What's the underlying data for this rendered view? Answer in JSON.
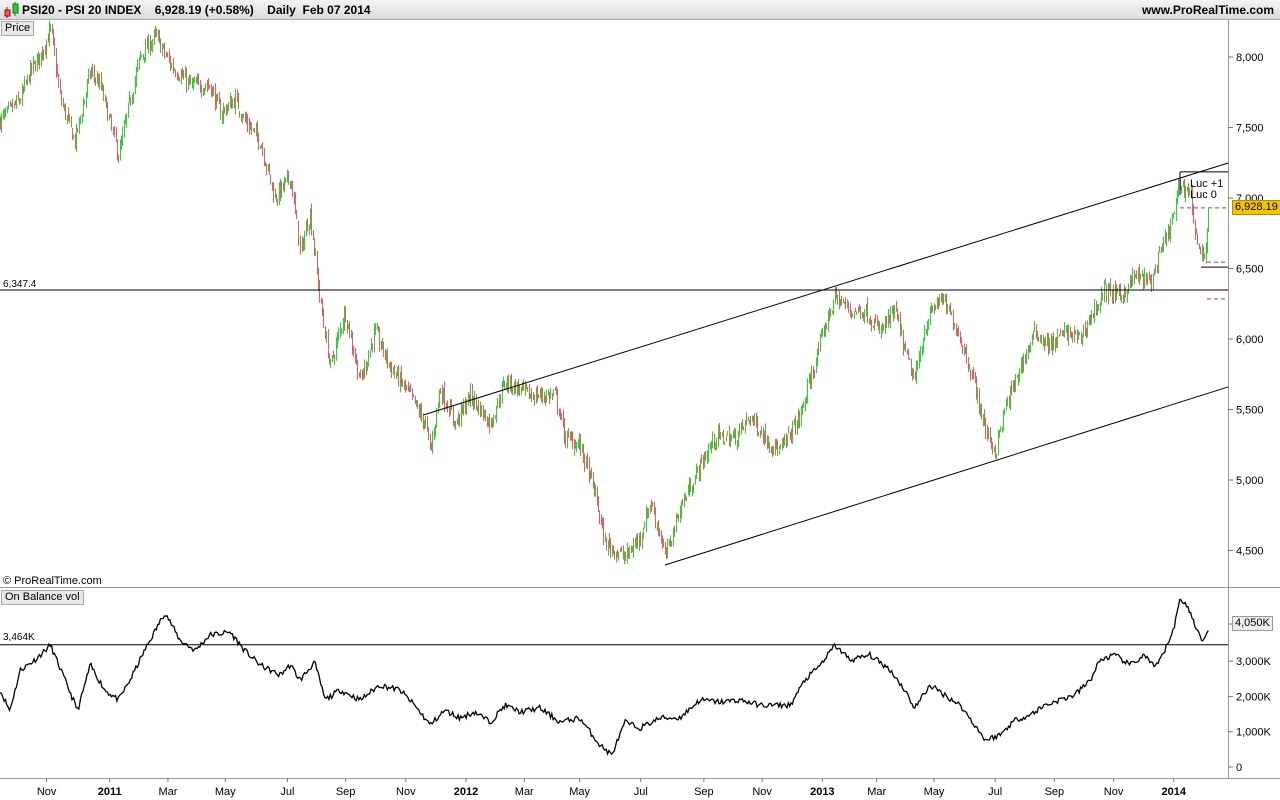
{
  "header": {
    "symbol": "PSI20 - PSI 20 INDEX",
    "last": "6,928.19 (+0.58%)",
    "period": "Daily",
    "date": "Feb 07 2014",
    "site": "www.ProRealTime.com"
  },
  "price_panel": {
    "label": "Price",
    "copyright": "© ProRealTime.com",
    "hline_label": "6,347.4",
    "last_label": "6,928.19",
    "annotations": [
      "Luc +1",
      "Luc 0"
    ]
  },
  "obv_panel": {
    "label": "On Balance vol",
    "hline_label": "3,464K",
    "last_label": "4,050K"
  },
  "colors": {
    "up": "#33cc33",
    "down": "#e06060",
    "last_bg": "#f5c400"
  },
  "chart_data": [
    {
      "type": "candlestick",
      "title": "PSI20 - PSI 20 INDEX Daily",
      "x_unit": "days since first bar",
      "ylim": [
        4300,
        8300
      ],
      "yticks": [
        4500,
        5000,
        5500,
        6000,
        6500,
        7000,
        7500,
        8000
      ],
      "ytick_labels": [
        "4,500",
        "5,000",
        "5,500",
        "6,000",
        "6,500",
        "7,000",
        "7,500",
        "8,000"
      ],
      "close_path": [
        [
          0,
          7550
        ],
        [
          21,
          7700
        ],
        [
          31,
          7900
        ],
        [
          41,
          8000
        ],
        [
          52,
          8200
        ],
        [
          62,
          7700
        ],
        [
          77,
          7400
        ],
        [
          93,
          7900
        ],
        [
          103,
          7800
        ],
        [
          122,
          7300
        ],
        [
          134,
          7700
        ],
        [
          144,
          8000
        ],
        [
          160,
          8150
        ],
        [
          175,
          7950
        ],
        [
          196,
          7800
        ],
        [
          216,
          7800
        ],
        [
          227,
          7600
        ],
        [
          242,
          7700
        ],
        [
          252,
          7550
        ],
        [
          268,
          7400
        ],
        [
          283,
          7000
        ],
        [
          299,
          7150
        ],
        [
          309,
          6600
        ],
        [
          319,
          6900
        ],
        [
          330,
          6250
        ],
        [
          340,
          5800
        ],
        [
          355,
          6200
        ],
        [
          371,
          5700
        ],
        [
          386,
          6050
        ],
        [
          402,
          5800
        ],
        [
          422,
          5600
        ],
        [
          438,
          5400
        ],
        [
          443,
          5200
        ],
        [
          453,
          5650
        ],
        [
          469,
          5400
        ],
        [
          484,
          5600
        ],
        [
          505,
          5400
        ],
        [
          520,
          5700
        ],
        [
          546,
          5600
        ],
        [
          572,
          5600
        ],
        [
          582,
          5300
        ],
        [
          597,
          5250
        ],
        [
          613,
          4900
        ],
        [
          623,
          4550
        ],
        [
          644,
          4450
        ],
        [
          659,
          4600
        ],
        [
          670,
          4850
        ],
        [
          680,
          4600
        ],
        [
          685,
          4450
        ],
        [
          700,
          4800
        ],
        [
          721,
          5100
        ],
        [
          736,
          5300
        ],
        [
          757,
          5300
        ],
        [
          773,
          5450
        ],
        [
          788,
          5300
        ],
        [
          803,
          5200
        ],
        [
          824,
          5450
        ],
        [
          834,
          5700
        ],
        [
          850,
          6100
        ],
        [
          860,
          6300
        ],
        [
          876,
          6200
        ],
        [
          891,
          6200
        ],
        [
          906,
          6050
        ],
        [
          922,
          6200
        ],
        [
          932,
          5900
        ],
        [
          942,
          5700
        ],
        [
          953,
          6100
        ],
        [
          968,
          6300
        ],
        [
          984,
          6100
        ],
        [
          999,
          5800
        ],
        [
          1015,
          5350
        ],
        [
          1025,
          5200
        ],
        [
          1035,
          5500
        ],
        [
          1051,
          5800
        ],
        [
          1066,
          6050
        ],
        [
          1082,
          5950
        ],
        [
          1097,
          6050
        ],
        [
          1112,
          6000
        ],
        [
          1123,
          6150
        ],
        [
          1138,
          6350
        ],
        [
          1154,
          6300
        ],
        [
          1169,
          6450
        ],
        [
          1185,
          6400
        ],
        [
          1200,
          6700
        ],
        [
          1210,
          6900
        ],
        [
          1215,
          7100
        ],
        [
          1226,
          7050
        ],
        [
          1231,
          6750
        ],
        [
          1239,
          6550
        ],
        [
          1246,
          6928.19
        ]
      ],
      "lines": [
        {
          "name": "channel-top",
          "from": [
            436,
            5461
          ],
          "to": [
            1265,
            7248
          ]
        },
        {
          "name": "channel-bottom",
          "from": [
            685,
            4397
          ],
          "to": [
            1265,
            5660
          ]
        },
        {
          "name": "support",
          "value": 6347.4
        }
      ],
      "markers": [
        {
          "name": "luc-plus-1",
          "value": 7185
        },
        {
          "name": "luc-0",
          "value": 6510
        }
      ],
      "dashed_levels": [
        6930,
        6545,
        6285
      ]
    },
    {
      "type": "line",
      "title": "On Balance vol",
      "ylim": [
        -300,
        5000
      ],
      "yticks": [
        0,
        1000,
        2000,
        3000,
        4050
      ],
      "ytick_labels": [
        "0",
        "1,000K",
        "2,000K",
        "3,000K",
        "4,050K"
      ],
      "points": [
        [
          0,
          2180
        ],
        [
          10,
          1600
        ],
        [
          21,
          2750
        ],
        [
          36,
          3030
        ],
        [
          52,
          3450
        ],
        [
          67,
          2460
        ],
        [
          80,
          1600
        ],
        [
          93,
          2890
        ],
        [
          108,
          2180
        ],
        [
          122,
          1900
        ],
        [
          134,
          2460
        ],
        [
          149,
          3300
        ],
        [
          170,
          4390
        ],
        [
          185,
          3600
        ],
        [
          201,
          3300
        ],
        [
          216,
          3740
        ],
        [
          237,
          3820
        ],
        [
          252,
          3300
        ],
        [
          268,
          2890
        ],
        [
          288,
          2600
        ],
        [
          299,
          2890
        ],
        [
          309,
          2460
        ],
        [
          324,
          2970
        ],
        [
          335,
          1900
        ],
        [
          350,
          2180
        ],
        [
          371,
          1900
        ],
        [
          391,
          2320
        ],
        [
          412,
          2180
        ],
        [
          427,
          1750
        ],
        [
          443,
          1190
        ],
        [
          458,
          1600
        ],
        [
          474,
          1390
        ],
        [
          489,
          1560
        ],
        [
          505,
          1270
        ],
        [
          520,
          1750
        ],
        [
          536,
          1560
        ],
        [
          556,
          1670
        ],
        [
          577,
          1270
        ],
        [
          597,
          1390
        ],
        [
          618,
          620
        ],
        [
          630,
          340
        ],
        [
          644,
          1270
        ],
        [
          659,
          1100
        ],
        [
          680,
          1390
        ],
        [
          700,
          1390
        ],
        [
          721,
          1900
        ],
        [
          742,
          1840
        ],
        [
          762,
          1900
        ],
        [
          783,
          1750
        ],
        [
          814,
          1750
        ],
        [
          829,
          2460
        ],
        [
          845,
          2890
        ],
        [
          860,
          3450
        ],
        [
          876,
          3030
        ],
        [
          896,
          3170
        ],
        [
          917,
          2750
        ],
        [
          932,
          2180
        ],
        [
          942,
          1670
        ],
        [
          958,
          2320
        ],
        [
          973,
          2040
        ],
        [
          989,
          1750
        ],
        [
          1004,
          1190
        ],
        [
          1015,
          760
        ],
        [
          1030,
          910
        ],
        [
          1045,
          1330
        ],
        [
          1061,
          1470
        ],
        [
          1076,
          1750
        ],
        [
          1092,
          1900
        ],
        [
          1107,
          2040
        ],
        [
          1123,
          2460
        ],
        [
          1133,
          3030
        ],
        [
          1148,
          3170
        ],
        [
          1164,
          2890
        ],
        [
          1179,
          3170
        ],
        [
          1190,
          2800
        ],
        [
          1200,
          3300
        ],
        [
          1210,
          4020
        ],
        [
          1215,
          4730
        ],
        [
          1221,
          4670
        ],
        [
          1231,
          4020
        ],
        [
          1239,
          3510
        ],
        [
          1246,
          4050
        ]
      ],
      "hline": 3464
    },
    {
      "type": "x-axis",
      "labels": [
        {
          "text": "Nov",
          "day": 48
        },
        {
          "text": "2011",
          "day": 113
        },
        {
          "text": "Mar",
          "day": 173
        },
        {
          "text": "May",
          "day": 232
        },
        {
          "text": "Jul",
          "day": 296
        },
        {
          "text": "Sep",
          "day": 356
        },
        {
          "text": "Nov",
          "day": 418
        },
        {
          "text": "2012",
          "day": 480
        },
        {
          "text": "Mar",
          "day": 540
        },
        {
          "text": "May",
          "day": 597
        },
        {
          "text": "Jul",
          "day": 660
        },
        {
          "text": "Sep",
          "day": 725
        },
        {
          "text": "Nov",
          "day": 785
        },
        {
          "text": "2013",
          "day": 847
        },
        {
          "text": "Mar",
          "day": 903
        },
        {
          "text": "May",
          "day": 962
        },
        {
          "text": "Jul",
          "day": 1025
        },
        {
          "text": "Sep",
          "day": 1086
        },
        {
          "text": "Nov",
          "day": 1147
        },
        {
          "text": "2014",
          "day": 1209
        }
      ]
    }
  ]
}
